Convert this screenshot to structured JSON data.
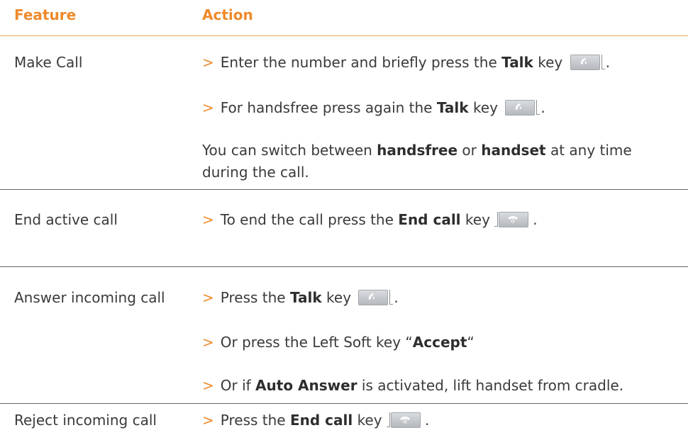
{
  "header": {
    "feature": "Feature",
    "action": "Action"
  },
  "rows": {
    "make_call": {
      "feature": "Make Call",
      "line1": {
        "gt": ">",
        "pre": "Enter the number and briefly press the",
        "bold": "Talk",
        "post": "key",
        "end": "."
      },
      "line2": {
        "gt": ">",
        "pre": "For handsfree press again the",
        "bold": "Talk",
        "post": "key",
        "end": "."
      },
      "note": {
        "p1": "You can switch between",
        "b1": "handsfree",
        "p2": "or",
        "b2": "handset",
        "p3": "at any time during the call."
      }
    },
    "end_call": {
      "feature": "End active call",
      "line1": {
        "gt": ">",
        "pre": "To end the call press the",
        "bold": "End call",
        "post": "key",
        "end": "."
      }
    },
    "answer_call": {
      "feature": "Answer incoming call",
      "line1": {
        "gt": ">",
        "pre": "Press the",
        "bold": "Talk",
        "post": "key",
        "end": "."
      },
      "line2": {
        "gt": ">",
        "pre": "Or press the Left Soft key “",
        "bold": "Accept",
        "post": "“"
      },
      "line3": {
        "gt": ">",
        "pre": "Or if",
        "bold": "Auto Answer",
        "post": "is activated, lift handset from cradle."
      }
    },
    "reject_call": {
      "feature": "Reject incoming call",
      "line1": {
        "gt": ">",
        "pre": "Press the",
        "bold": "End call",
        "post": "key",
        "end": "."
      }
    }
  },
  "icons": {
    "talk": "talk-key-icon",
    "end": "end-call-key-icon"
  },
  "colors": {
    "accent": "#ee8a2a",
    "text": "#3a3a3a",
    "rule": "#666666"
  }
}
